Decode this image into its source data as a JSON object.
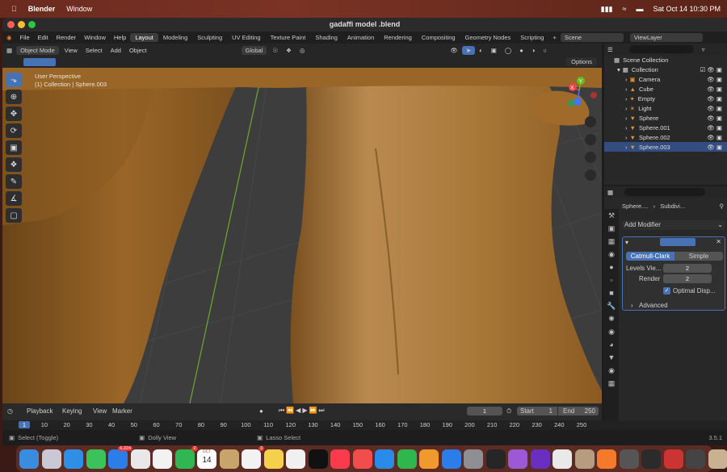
{
  "mac_menu": {
    "app": "Blender",
    "items": [
      "Window"
    ],
    "clock": "Sat Oct 14  10:30 PM"
  },
  "window": {
    "title": "gadaffi model .blend"
  },
  "menubar": {
    "items": [
      "File",
      "Edit",
      "Render",
      "Window",
      "Help"
    ],
    "workspaces": [
      "Layout",
      "Modeling",
      "Sculpting",
      "UV Editing",
      "Texture Paint",
      "Shading",
      "Animation",
      "Rendering",
      "Compositing",
      "Geometry Nodes",
      "Scripting"
    ],
    "active_workspace": "Layout",
    "scene": "Scene",
    "view_layer": "ViewLayer"
  },
  "header": {
    "mode": "Object Mode",
    "menus": [
      "View",
      "Select",
      "Add",
      "Object"
    ],
    "transform": "Global",
    "options": "Options"
  },
  "viewport": {
    "perspective": "User Perspective",
    "collection": "(1) Collection | Sphere.003",
    "gizmo": {
      "x": "X",
      "y": "Y",
      "z": "Z"
    }
  },
  "outliner": {
    "root": "Scene Collection",
    "collection": "Collection",
    "items": [
      "Camera",
      "Cube",
      "Empty",
      "Light",
      "Sphere",
      "Sphere.001",
      "Sphere.002",
      "Sphere.003"
    ]
  },
  "properties": {
    "object": "Sphere....",
    "modifier": "Subdivi...",
    "add_modifier": "Add Modifier",
    "catmull": "Catmull-Clark",
    "simple": "Simple",
    "levels_label": "Levels Vie...",
    "levels_value": "2",
    "render_label": "Render",
    "render_value": "2",
    "optimal": "Optimal Disp...",
    "advanced": "Advanced"
  },
  "timeline": {
    "menus": [
      "Playback",
      "Keying",
      "View",
      "Marker"
    ],
    "current": "1",
    "start_label": "Start",
    "start": "1",
    "end_label": "End",
    "end": "250"
  },
  "ruler": {
    "ticks": [
      "1",
      "10",
      "20",
      "30",
      "40",
      "50",
      "60",
      "70",
      "80",
      "90",
      "100",
      "110",
      "120",
      "130",
      "140",
      "150",
      "160",
      "170",
      "180",
      "190",
      "200",
      "210",
      "220",
      "230",
      "240",
      "250"
    ]
  },
  "status": {
    "left": "Select (Toggle)",
    "mid": "Dolly View",
    "right": "Lasso Select",
    "version": "3.5.1"
  },
  "dock": {
    "mail_badge": "6,224",
    "msg_badge": "2",
    "date_month": "OCT",
    "date_day": "14",
    "calendar_badge": "3"
  }
}
